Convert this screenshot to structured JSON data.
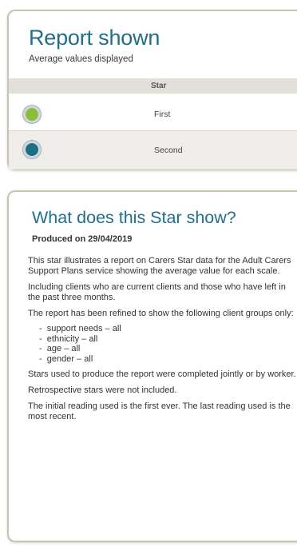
{
  "report": {
    "title": "Report shown",
    "subtitle": "Average values displayed",
    "column_header": "Star",
    "stars": [
      {
        "label": "First",
        "color": "#8bbf3a",
        "icon": "green-circle-icon"
      },
      {
        "label": "Second",
        "color": "#1a6f82",
        "icon": "teal-circle-icon"
      }
    ]
  },
  "info": {
    "title": "What does this Star show?",
    "produced": "Produced on 29/04/2019",
    "p1": "This star illustrates a report on Carers Star data for the Adult Carers Support Plans service showing the average value for each scale.",
    "p2": "Including clients who are current clients and those who have left in the past three months.",
    "p3": "The report has been refined to show the following client groups only:",
    "groups": [
      "support needs – all",
      "ethnicity – all",
      "age – all",
      "gender – all"
    ],
    "p4": "Stars used to produce the report were completed jointly or by worker.",
    "p5": "Retrospective stars were not included.",
    "p6": "The initial reading used is the first ever. The last reading used is the most recent."
  },
  "colors": {
    "accent": "#1f6f8b",
    "first": "#8bbf3a",
    "second": "#1a6f82"
  }
}
